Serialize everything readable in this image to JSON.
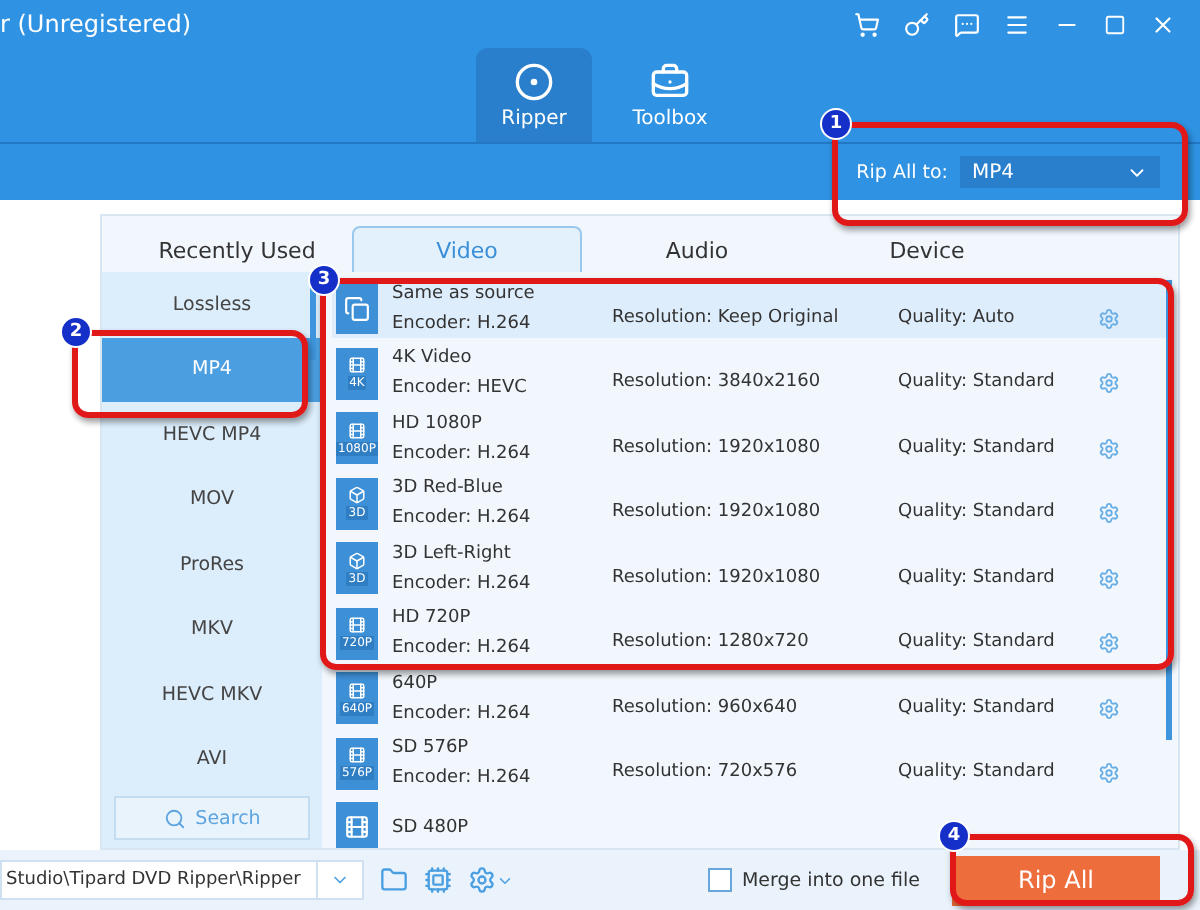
{
  "window": {
    "title": "r (Unregistered)"
  },
  "nav": [
    {
      "label": "Ripper",
      "selected": true
    },
    {
      "label": "Toolbox",
      "selected": false
    }
  ],
  "rip_all_to": {
    "label": "Rip All to:",
    "value": "MP4"
  },
  "format_tabs": [
    {
      "label": "Recently Used",
      "selected": false
    },
    {
      "label": "Video",
      "selected": true
    },
    {
      "label": "Audio",
      "selected": false
    },
    {
      "label": "Device",
      "selected": false
    }
  ],
  "formats": [
    {
      "label": "Lossless",
      "selected": false
    },
    {
      "label": "MP4",
      "selected": true
    },
    {
      "label": "HEVC MP4",
      "selected": false
    },
    {
      "label": "MOV",
      "selected": false
    },
    {
      "label": "ProRes",
      "selected": false
    },
    {
      "label": "MKV",
      "selected": false
    },
    {
      "label": "HEVC MKV",
      "selected": false
    },
    {
      "label": "AVI",
      "selected": false
    }
  ],
  "search": {
    "placeholder": "Search"
  },
  "presets": [
    {
      "kind": "copy",
      "title": "Same as source",
      "encoder": "Encoder: H.264",
      "resolution": "Resolution: Keep Original",
      "quality": "Quality: Auto",
      "selected": true
    },
    {
      "kind": "film",
      "badge": "4K",
      "title": "4K Video",
      "encoder": "Encoder: HEVC",
      "resolution": "Resolution: 3840x2160",
      "quality": "Quality: Standard",
      "selected": false
    },
    {
      "kind": "film",
      "badge": "1080P",
      "title": "HD 1080P",
      "encoder": "Encoder: H.264",
      "resolution": "Resolution: 1920x1080",
      "quality": "Quality: Standard",
      "selected": false
    },
    {
      "kind": "cube",
      "badge": "3D",
      "title": "3D Red-Blue",
      "encoder": "Encoder: H.264",
      "resolution": "Resolution: 1920x1080",
      "quality": "Quality: Standard",
      "selected": false
    },
    {
      "kind": "cube",
      "badge": "3D",
      "title": "3D Left-Right",
      "encoder": "Encoder: H.264",
      "resolution": "Resolution: 1920x1080",
      "quality": "Quality: Standard",
      "selected": false
    },
    {
      "kind": "film",
      "badge": "720P",
      "title": "HD 720P",
      "encoder": "Encoder: H.264",
      "resolution": "Resolution: 1280x720",
      "quality": "Quality: Standard",
      "selected": false
    },
    {
      "kind": "film",
      "badge": "640P",
      "title": "640P",
      "encoder": "Encoder: H.264",
      "resolution": "Resolution: 960x640",
      "quality": "Quality: Standard",
      "selected": false
    },
    {
      "kind": "film",
      "badge": "576P",
      "title": "SD 576P",
      "encoder": "Encoder: H.264",
      "resolution": "Resolution: 720x576",
      "quality": "Quality: Standard",
      "selected": false
    },
    {
      "kind": "film",
      "title": "SD 480P",
      "selected": false
    }
  ],
  "bottom": {
    "path": "Studio\\Tipard DVD Ripper\\Ripper",
    "merge": {
      "label": "Merge into one file",
      "checked": false
    },
    "rip_button": "Rip All"
  },
  "callouts": [
    {
      "number": "1"
    },
    {
      "number": "2"
    },
    {
      "number": "3"
    },
    {
      "number": "4"
    }
  ]
}
